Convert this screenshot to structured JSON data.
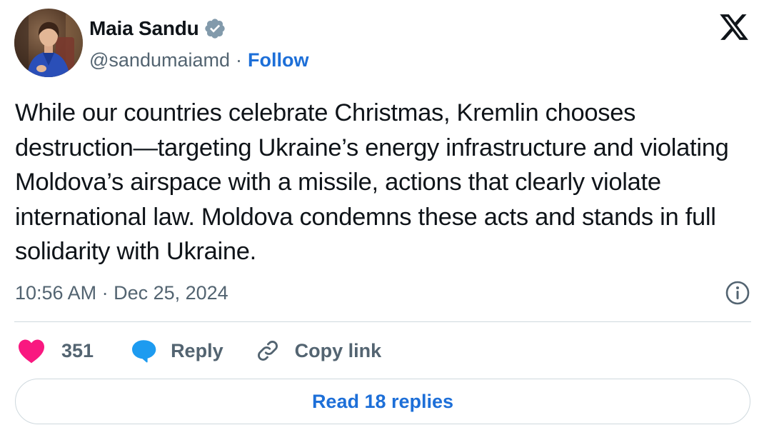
{
  "author": {
    "display_name": "Maia Sandu",
    "handle": "@sandumaiamd",
    "separator": "·",
    "follow_label": "Follow",
    "verified": true,
    "avatar_icon": "profile-photo"
  },
  "platform": {
    "logo_icon": "x-logo-icon"
  },
  "tweet": {
    "text": "While our countries celebrate Christmas, Kremlin chooses destruction—targeting Ukraine’s energy infrastructure and violating Moldova’s airspace with a missile, actions that clearly violate international law. Moldova condemns these acts and stands in full solidarity with Ukraine.",
    "timestamp": "10:56 AM · Dec 25, 2024"
  },
  "actions": {
    "like_count": "351",
    "reply_label": "Reply",
    "copy_link_label": "Copy link"
  },
  "replies_button": {
    "label": "Read 18 replies"
  },
  "colors": {
    "text_primary": "#0f1419",
    "text_secondary": "#536471",
    "link_blue": "#1d6fd8",
    "verified_gray": "#829aab",
    "like_pink": "#f91880",
    "reply_blue": "#1d9bf0",
    "border": "#cfd9de"
  }
}
